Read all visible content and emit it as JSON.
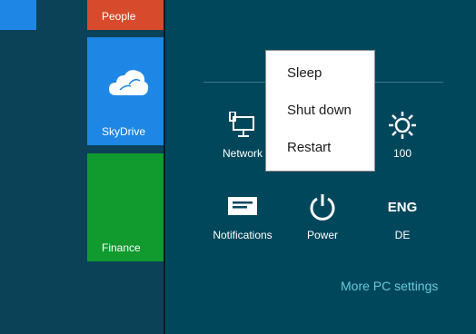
{
  "tiles": {
    "people_label": "People",
    "skydrive_label": "SkyDrive",
    "finance_label": "Finance"
  },
  "settings": {
    "network_label": "Network",
    "brightness_value": "100",
    "notifications_label": "Notifications",
    "power_label": "Power",
    "keyboard_code": "ENG",
    "keyboard_layout": "DE",
    "more_pc_settings": "More PC settings"
  },
  "power_menu": {
    "items": [
      "Sleep",
      "Shut down",
      "Restart"
    ]
  },
  "icons": {
    "network": "wired-network-icon",
    "brightness": "brightness-icon",
    "notifications": "notifications-icon",
    "power": "power-icon",
    "skydrive": "cloud-icon"
  },
  "colors": {
    "background": "#01475c",
    "people_tile": "#d84a2c",
    "skydrive_tile": "#1e87e6",
    "finance_tile": "#119a2e",
    "link": "#69c9d9"
  }
}
